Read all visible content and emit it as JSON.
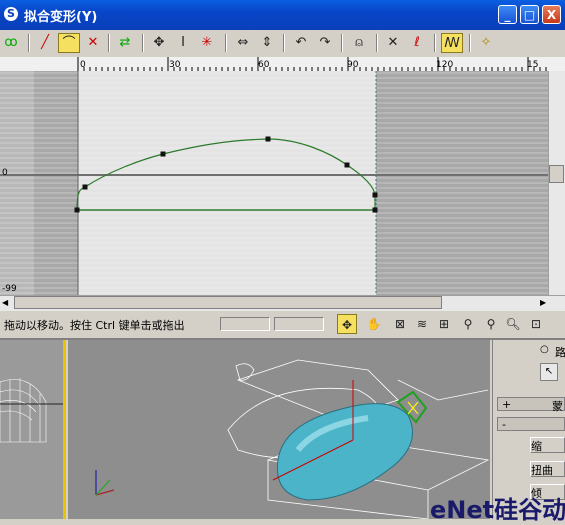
{
  "window": {
    "title": "拟合变形(Y)",
    "minimize_label": "_",
    "maximize_label": "□",
    "close_label": "X"
  },
  "toolbar": {
    "icons": [
      "curve-tool-icon",
      "line-icon",
      "bezier-corner-icon",
      "bezier-smooth-icon",
      "swap-icon",
      "move-icon",
      "scale-vertical-icon",
      "insert-point-icon",
      "horizontal-mirror-icon",
      "vertical-mirror-icon",
      "rotate-ccw-icon",
      "rotate-cw-icon",
      "lock-icon",
      "delete-point-icon",
      "reset-curve-icon",
      "generate-path-icon",
      "magic-wand-icon"
    ]
  },
  "ruler": {
    "ticks": [
      "0",
      "30",
      "60",
      "90",
      "120",
      "15"
    ]
  },
  "graph": {
    "row_label_zero": "0",
    "row_label_min": "-99"
  },
  "status": {
    "text": "拖动以移动。按住 Ctrl 键单击或拖出",
    "field1": "",
    "field2": ""
  },
  "viewport_tools": {
    "icons": [
      "move-lock-icon",
      "pan-hand-icon",
      "zoom-horizontal-icon",
      "zoom-vertical-icon",
      "zoom-extents-icon",
      "zoom-icon",
      "zoom-region-icon",
      "zoom-magnify-icon",
      "zoom-window-icon"
    ]
  },
  "command_panel": {
    "radio_label": "路",
    "rollout1_sign": "+",
    "rollout1_label": "蒙",
    "rollout2_sign": "-",
    "btn1": "缩",
    "btn2": "扭曲",
    "btn3": "倾"
  },
  "watermark": {
    "text": "eNet硅谷动力"
  },
  "colors": {
    "accent": "#f5e060",
    "curve": "#2a7a2a",
    "title_bar": "#0a3fb8",
    "mouse_body": "#4bb4c8"
  }
}
